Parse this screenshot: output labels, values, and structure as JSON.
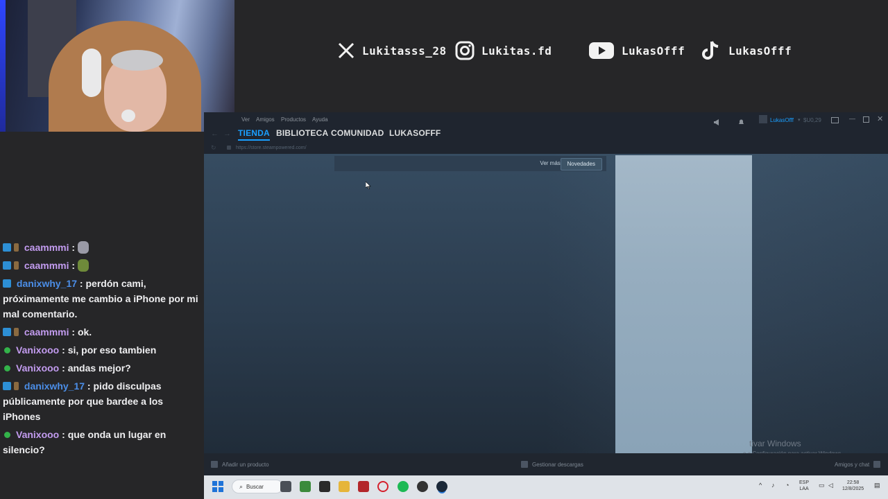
{
  "socials": [
    {
      "icon": "x-logo-icon",
      "handle": "Lukitasss_28"
    },
    {
      "icon": "instagram-icon",
      "handle": "Lukitas.fd"
    },
    {
      "icon": "youtube-icon",
      "handle": "LukasOfff"
    },
    {
      "icon": "tiktok-icon",
      "handle": "LukasOfff"
    }
  ],
  "chat": [
    {
      "user": "caammmi",
      "badges": [
        "mod",
        "bits"
      ],
      "text": "",
      "emote": "grey",
      "color": "#c39cf0"
    },
    {
      "user": "caammmi",
      "badges": [
        "mod",
        "bits"
      ],
      "text": "",
      "emote": "green",
      "color": "#c39cf0"
    },
    {
      "user": "danixwhy_17",
      "badges": [
        "mod"
      ],
      "text": "perdón cami, próximamente me cambio a iPhone por mi mal comentario.",
      "color": "#4b8ee8"
    },
    {
      "user": "caammmi",
      "badges": [
        "mod",
        "bits"
      ],
      "text": "ok.",
      "color": "#c39cf0"
    },
    {
      "user": "Vanixooo",
      "badges": [
        "ok"
      ],
      "text": "si, por eso tambien",
      "color": "#c39cf0"
    },
    {
      "user": "Vanixooo",
      "badges": [
        "ok"
      ],
      "text": "andas mejor?",
      "color": "#c39cf0"
    },
    {
      "user": "danixwhy_17",
      "badges": [
        "mod",
        "bits"
      ],
      "text": "pido disculpas públicamente por que bardee a los iPhones",
      "color": "#4b8ee8"
    },
    {
      "user": "Vanixooo",
      "badges": [
        "ok"
      ],
      "text": "que onda un lugar en silencio?",
      "color": "#c39cf0"
    }
  ],
  "steam": {
    "menu": [
      "Ver",
      "Amigos",
      "Productos",
      "Ayuda"
    ],
    "tabs": [
      "TIENDA",
      "BIBLIOTECA",
      "COMUNIDAD",
      "LUKASOFFF"
    ],
    "active_tab": "TIENDA",
    "account": "LukasOfff",
    "balance": "$U0,29",
    "url": "https://store.steampowered.com/",
    "ver_mas_label": "Ver más:",
    "novedades_label": "Novedades",
    "add_product": "Añadir un producto",
    "manage_downloads": "Gestionar descargas",
    "friends_chat": "Amigos y chat",
    "activation_title": "tivar Windows",
    "activation_sub": "e a Configuración para activar Windows."
  },
  "taskbar": {
    "search_label": "Buscar",
    "lang_top": "ESP",
    "lang_bottom": "LAA",
    "time": "22:58",
    "date": "12/8/2025"
  },
  "colors": {
    "steam_accent": "#1a9fff",
    "mod_badge": "#2d8fd5",
    "user_purple": "#c39cf0",
    "user_blue": "#4b8ee8"
  }
}
